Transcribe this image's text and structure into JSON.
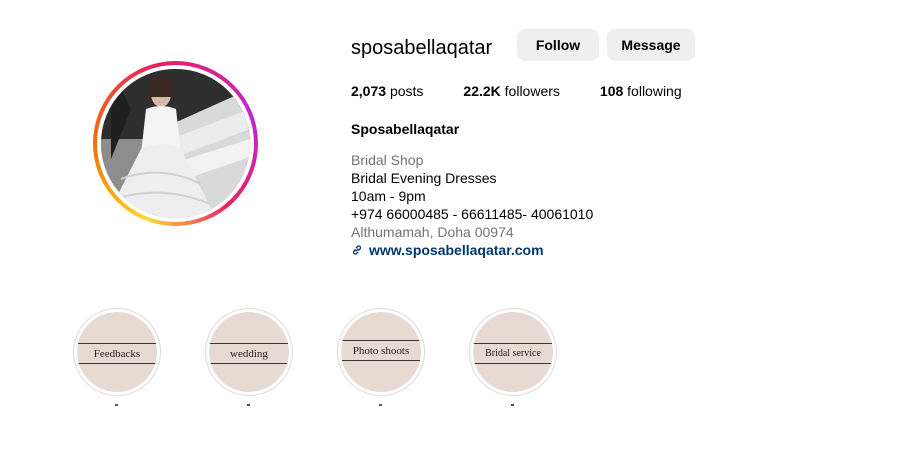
{
  "profile": {
    "username": "sposabellaqatar",
    "follow_label": "Follow",
    "message_label": "Message",
    "posts_count": "2,073",
    "posts_label": "posts",
    "followers_count": "22.2K",
    "followers_label": "followers",
    "following_count": "108",
    "following_label": "following",
    "full_name": "Sposabellaqatar",
    "category": "Bridal Shop",
    "bio_lines": [
      "Bridal Evening Dresses",
      "10am - 9pm",
      "+974 66000485 - 66611485- 40061010"
    ],
    "address": "Althumamah, Doha 00974",
    "website": "www.sposabellaqatar.com"
  },
  "highlights": [
    {
      "label": "Feedbacks"
    },
    {
      "label": "wedding"
    },
    {
      "label": "Photo  shoots"
    },
    {
      "label": "Bridal service"
    }
  ],
  "colors": {
    "button_bg": "#efefef",
    "link": "#00376b",
    "muted": "#737373",
    "highlight_bg": "#e6dad2"
  },
  "icons": {
    "link": "link-icon"
  }
}
